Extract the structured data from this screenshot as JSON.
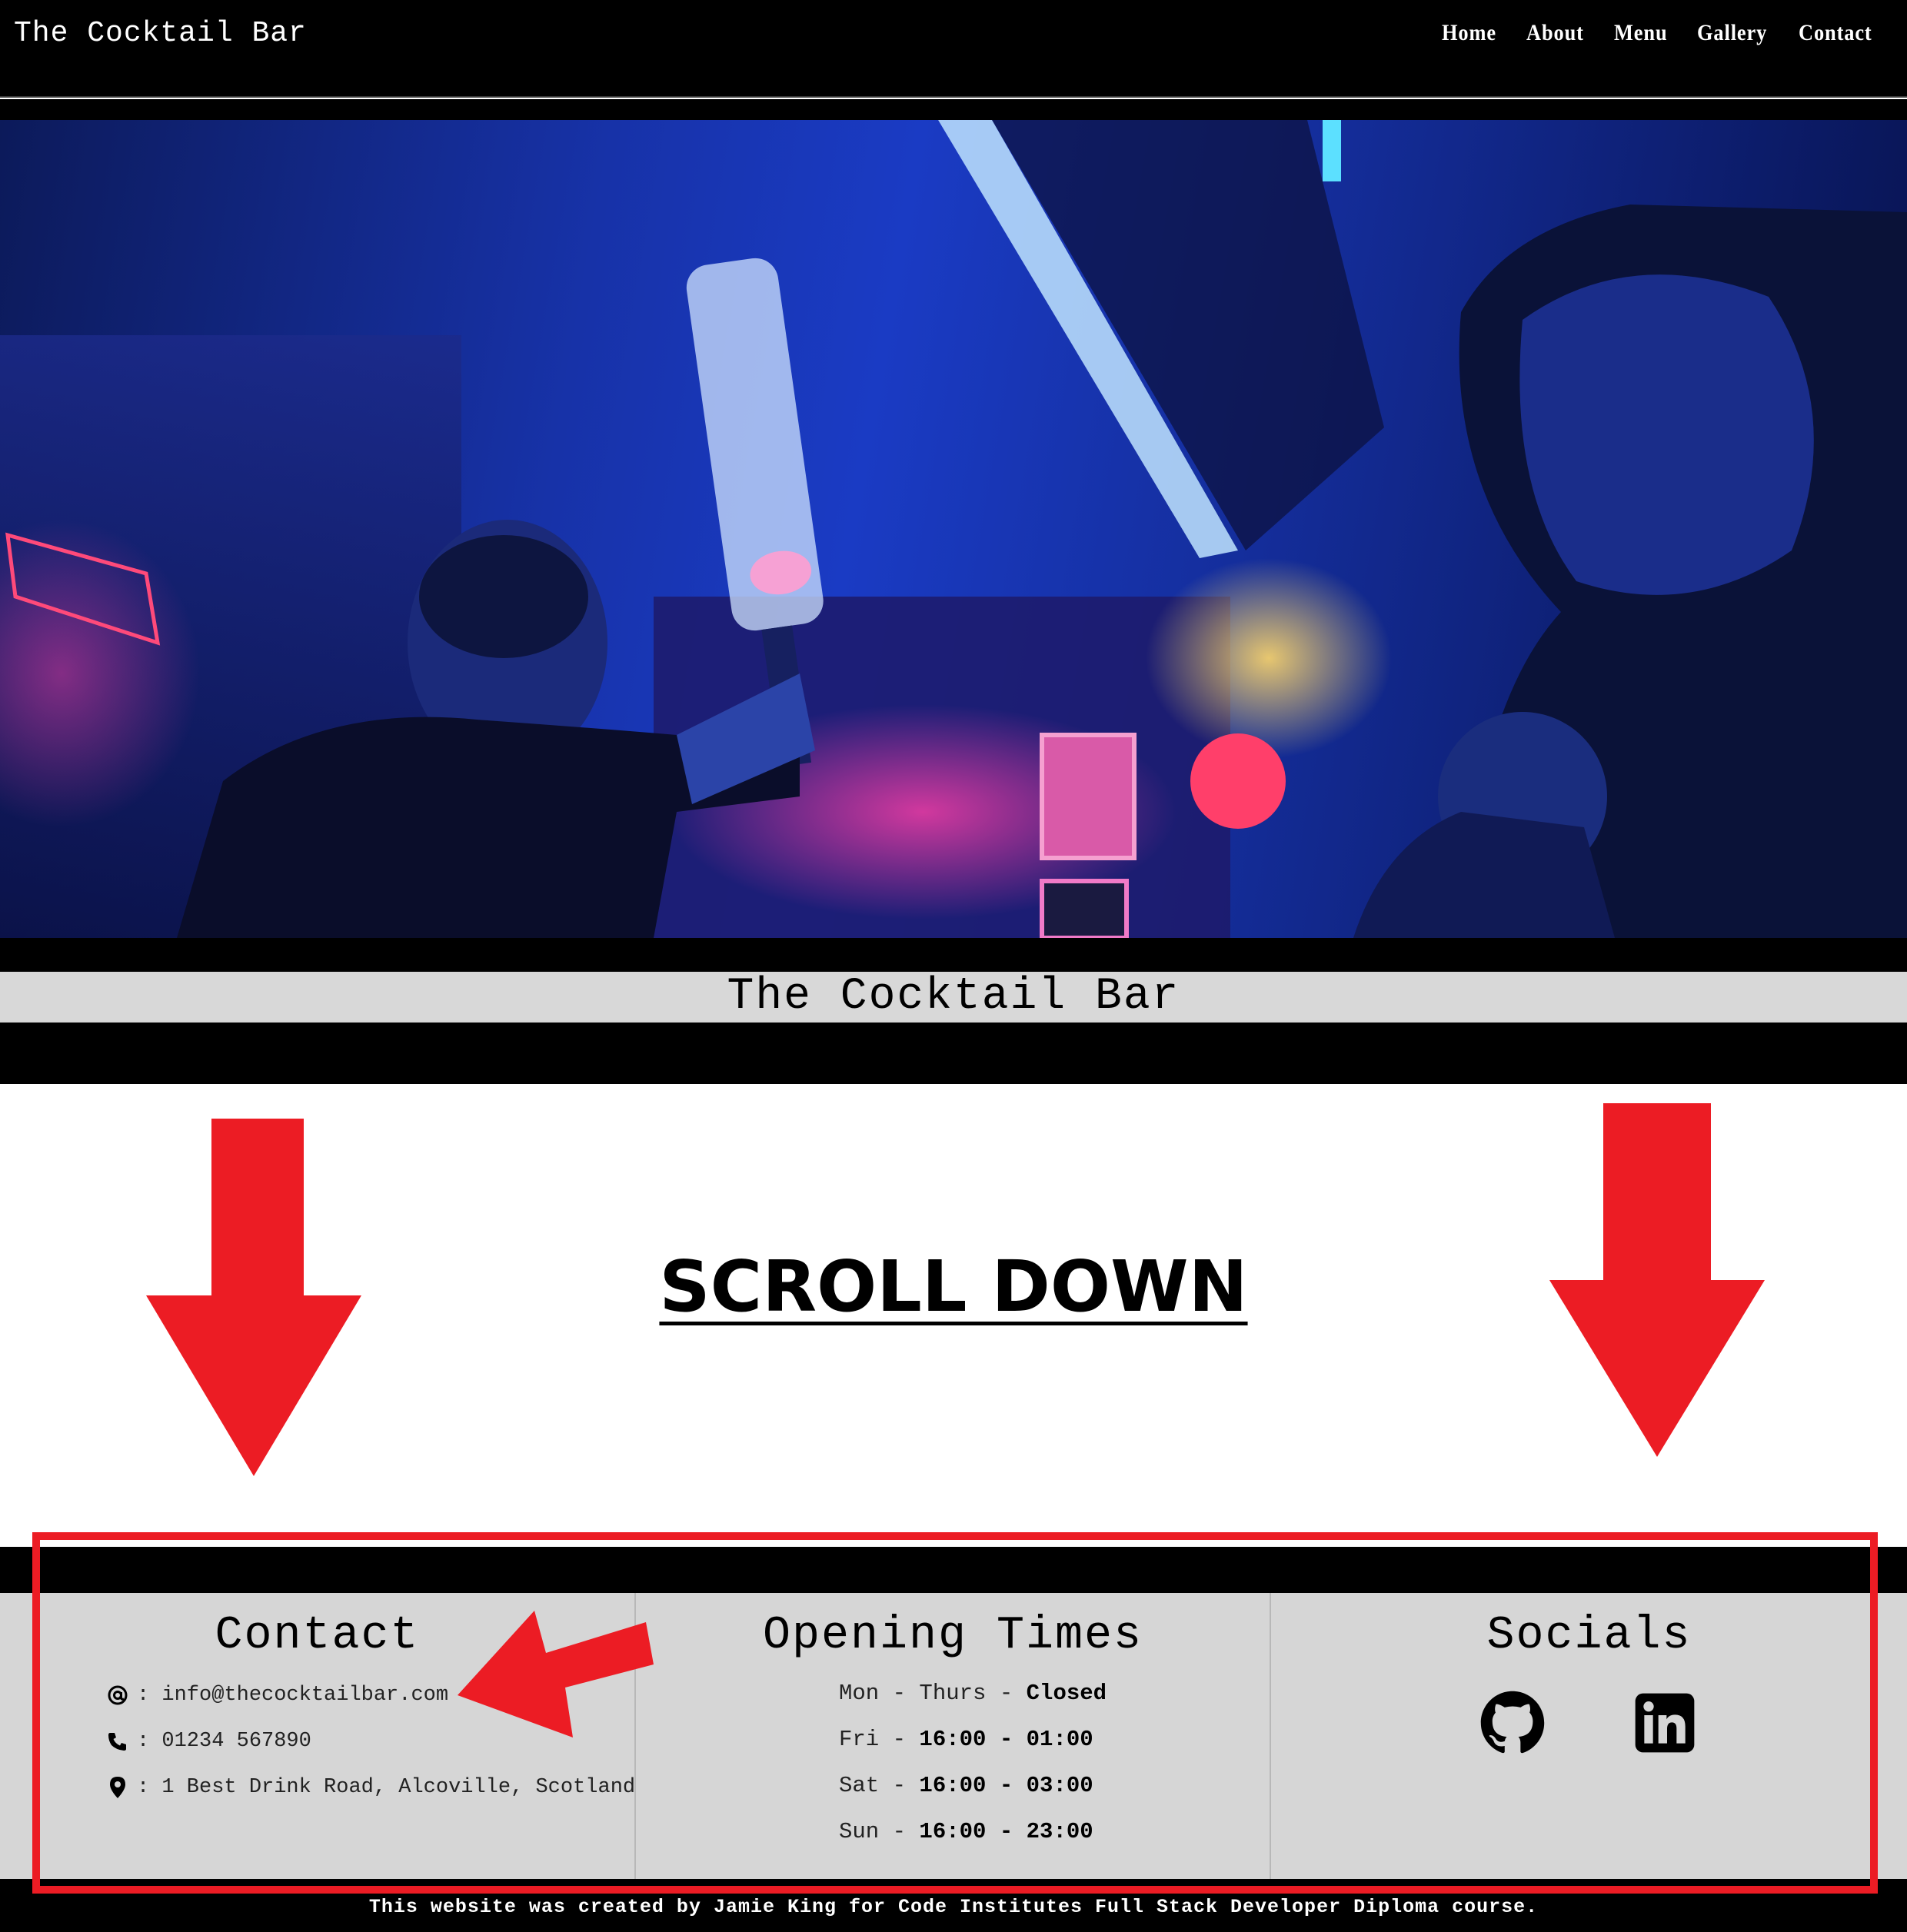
{
  "navbar": {
    "brand": "The Cocktail Bar",
    "links": [
      "Home",
      "About",
      "Menu",
      "Gallery",
      "Contact"
    ]
  },
  "hero": {
    "title": "The Cocktail Bar"
  },
  "annotation": {
    "label": "SCROLL DOWN",
    "color": "#ec1c24"
  },
  "footer": {
    "contact": {
      "heading": "Contact",
      "email": ": info@thecocktailbar.com",
      "phone": ": 01234 567890",
      "address": ": 1 Best Drink Road, Alcoville, Scotland"
    },
    "opening_times": {
      "heading": "Opening Times",
      "rows": [
        {
          "day": "Mon - Thurs -",
          "hours": "Closed"
        },
        {
          "day": "Fri -",
          "hours": "16:00 - 01:00"
        },
        {
          "day": "Sat -",
          "hours": "16:00 - 03:00"
        },
        {
          "day": "Sun -",
          "hours": "16:00 - 23:00"
        }
      ]
    },
    "socials": {
      "heading": "Socials",
      "icons": [
        "github-icon",
        "linkedin-icon"
      ]
    },
    "credit": "This website was created by Jamie King for Code Institutes Full Stack Developer Diploma course."
  }
}
